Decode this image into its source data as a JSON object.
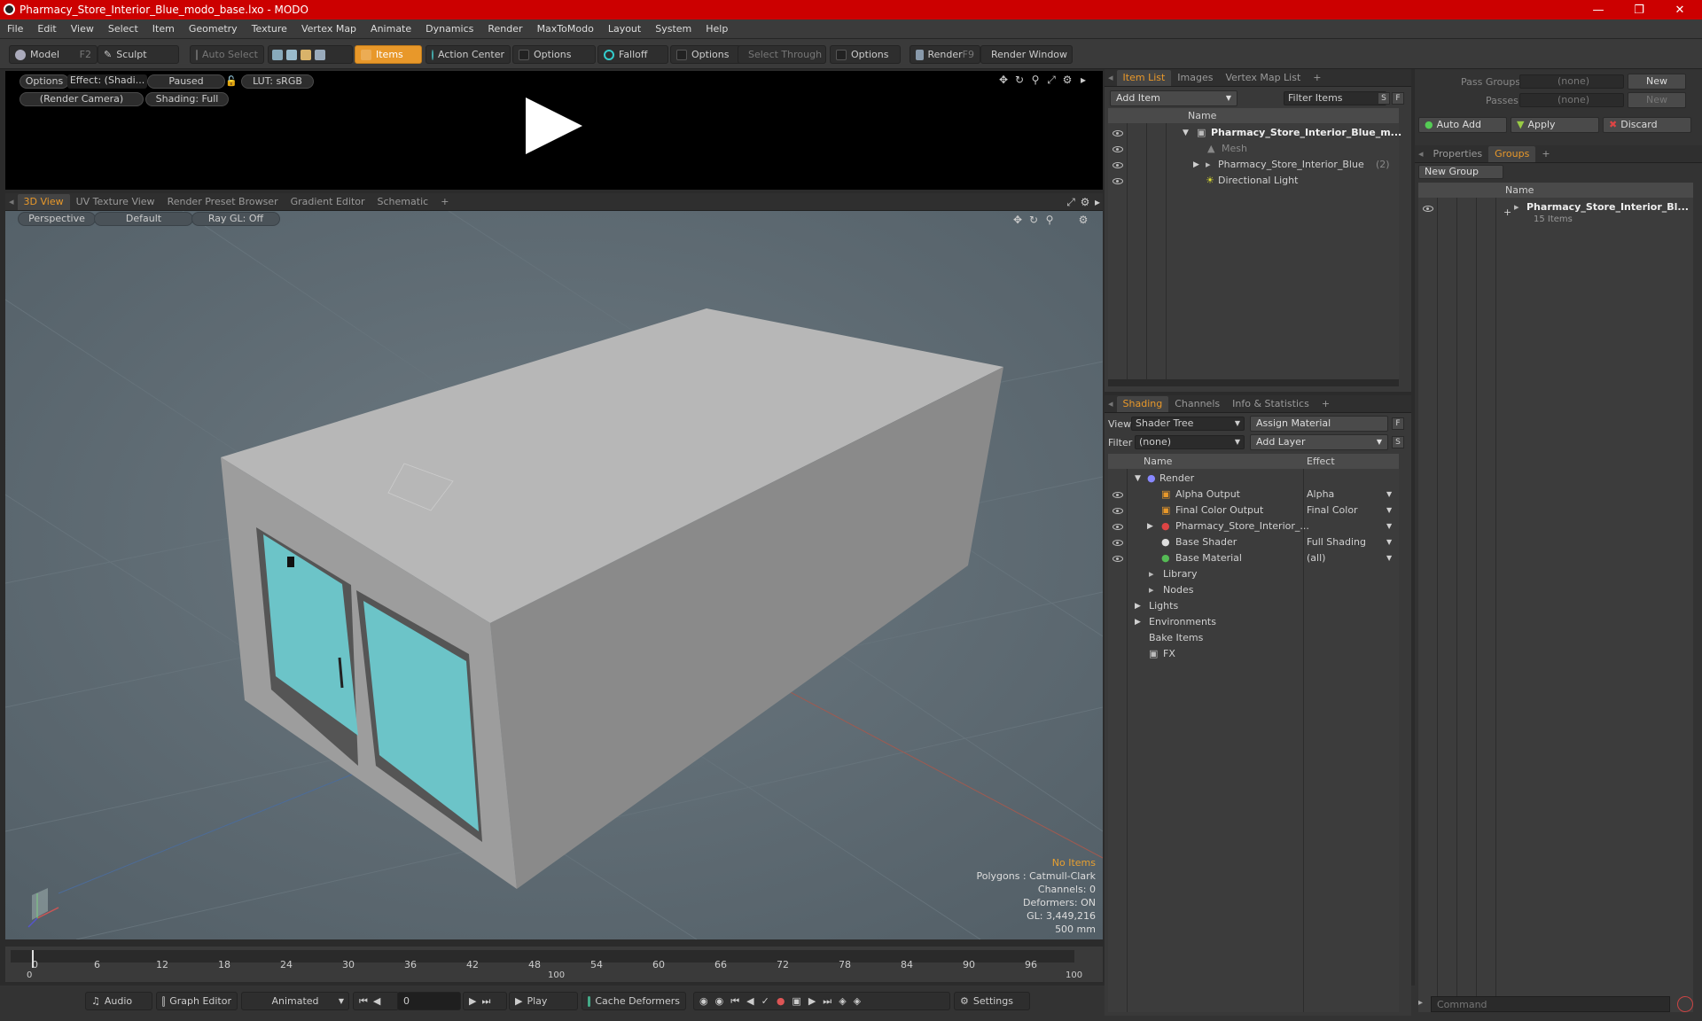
{
  "window": {
    "title": "Pharmacy_Store_Interior_Blue_modo_base.lxo - MODO"
  },
  "menu": [
    "File",
    "Edit",
    "View",
    "Select",
    "Item",
    "Geometry",
    "Texture",
    "Vertex Map",
    "Animate",
    "Dynamics",
    "Render",
    "MaxToModo",
    "Layout",
    "System",
    "Help"
  ],
  "toolbar": {
    "model": "Model",
    "model_key": "F2",
    "sculpt": "Sculpt",
    "auto_select": "Auto Select",
    "items": "Items",
    "action_center": "Action Center",
    "options1": "Options",
    "falloff": "Falloff",
    "options2": "Options",
    "select_through": "Select Through",
    "options3": "Options",
    "render": "Render",
    "render_key": "F9",
    "render_window": "Render Window"
  },
  "preview": {
    "options": "Options",
    "effect": "Effect: (Shadi...",
    "paused": "Paused",
    "lut": "LUT: sRGB",
    "camera": "(Render Camera)",
    "shading": "Shading: Full"
  },
  "viewtabs": [
    "3D View",
    "UV Texture View",
    "Render Preset Browser",
    "Gradient Editor",
    "Schematic"
  ],
  "viewport": {
    "perspective": "Perspective",
    "default": "Default",
    "raygl": "Ray GL: Off"
  },
  "status": {
    "line1": "No Items",
    "line2": "Polygons : Catmull-Clark",
    "line3": "Channels: 0",
    "line4": "Deformers: ON",
    "line5": "GL: 3,449,216",
    "line6": "500 mm"
  },
  "timeline": {
    "ticks": [
      "0",
      "6",
      "12",
      "18",
      "24",
      "30",
      "36",
      "42",
      "48",
      "54",
      "60",
      "66",
      "72",
      "78",
      "84",
      "90",
      "96"
    ],
    "sub_left": "0",
    "sub_mid": "100",
    "sub_right": "100"
  },
  "bottombar": {
    "audio": "Audio",
    "graph_editor": "Graph Editor",
    "animated": "Animated",
    "frame": "0",
    "play": "Play",
    "cache": "Cache Deformers",
    "settings": "Settings"
  },
  "itemlist": {
    "tabs": [
      "Item List",
      "Images",
      "Vertex Map List"
    ],
    "add_item": "Add Item",
    "filter": "Filter Items",
    "s": "S",
    "f": "F",
    "col_name": "Name",
    "rows": [
      {
        "label": "Pharmacy_Store_Interior_Blue_m...",
        "bold": true
      },
      {
        "label": "Mesh",
        "dim": true
      },
      {
        "label": "Pharmacy_Store_Interior_Blue",
        "suffix": "(2)"
      },
      {
        "label": "Directional Light"
      }
    ]
  },
  "shading": {
    "tabs": [
      "Shading",
      "Channels",
      "Info & Statistics"
    ],
    "view_label": "View",
    "view_value": "Shader Tree",
    "assign": "Assign Material",
    "f": "F",
    "filter_label": "Filter",
    "filter_value": "(none)",
    "add_layer": "Add Layer",
    "s": "S",
    "col_name": "Name",
    "col_effect": "Effect",
    "rows": [
      {
        "label": "Render",
        "effect": ""
      },
      {
        "label": "Alpha Output",
        "effect": "Alpha"
      },
      {
        "label": "Final Color Output",
        "effect": "Final Color"
      },
      {
        "label": "Pharmacy_Store_Interior_...",
        "effect": ""
      },
      {
        "label": "Base Shader",
        "effect": "Full Shading"
      },
      {
        "label": "Base Material",
        "effect": "(all)"
      },
      {
        "label": "Library",
        "effect": ""
      },
      {
        "label": "Nodes",
        "effect": ""
      },
      {
        "label": "Lights",
        "effect": ""
      },
      {
        "label": "Environments",
        "effect": ""
      },
      {
        "label": "Bake Items",
        "effect": ""
      },
      {
        "label": "FX",
        "effect": ""
      }
    ]
  },
  "groups": {
    "pass_groups": "Pass Groups",
    "passes": "Passes",
    "none1": "(none)",
    "none2": "(none)",
    "new1": "New",
    "new2": "New",
    "auto_add": "Auto Add",
    "apply": "Apply",
    "discard": "Discard",
    "tabs": [
      "Properties",
      "Groups"
    ],
    "new_group": "New Group",
    "col_name": "Name",
    "item": "Pharmacy_Store_Interior_Bl...",
    "item_count": "15 Items"
  },
  "command": {
    "placeholder": "Command"
  }
}
